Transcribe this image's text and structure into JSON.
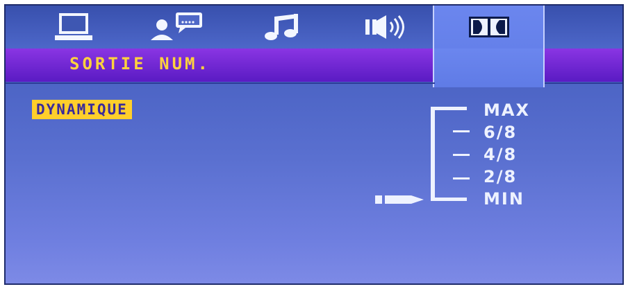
{
  "tabs": [
    {
      "id": "display",
      "icon": "monitor-icon"
    },
    {
      "id": "language",
      "icon": "person-chat-icon"
    },
    {
      "id": "audio",
      "icon": "music-note-icon"
    },
    {
      "id": "speaker",
      "icon": "speaker-icon"
    },
    {
      "id": "dolby",
      "icon": "dolby-icon"
    }
  ],
  "header": {
    "title": "SORTIE NUM."
  },
  "settings": {
    "selected_option": "DYNAMIQUE",
    "levels": [
      "MAX",
      "6/8",
      "4/8",
      "2/8",
      "MIN"
    ],
    "current_level": "MIN"
  },
  "colors": {
    "accent": "#ffcf2b",
    "title_text": "#ffd23d",
    "titlebar": "#7a2fd9",
    "background": "#4b63c4",
    "text": "#eef2ff"
  }
}
